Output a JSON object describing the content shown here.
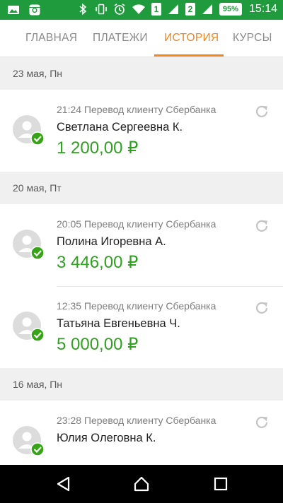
{
  "status_bar": {
    "time": "15:14",
    "battery": "95%",
    "sim1": "1",
    "sim2": "2",
    "left_icons": [
      "gallery-icon",
      "instagram-icon"
    ],
    "right_icons": [
      "bluetooth-icon",
      "vibrate-icon",
      "alarm-icon",
      "wifi-icon",
      "signal-icon"
    ]
  },
  "tabs": [
    {
      "label": "ГЛАВНАЯ",
      "active": false
    },
    {
      "label": "ПЛАТЕЖИ",
      "active": false
    },
    {
      "label": "ИСТОРИЯ",
      "active": true
    },
    {
      "label": "КУРСЫ",
      "active": false
    }
  ],
  "colors": {
    "status_bar": "#1f9a3c",
    "accent_tab": "#f0861c",
    "amount": "#2ea21f",
    "check_badge": "#37a317"
  },
  "groups": [
    {
      "date": "23 мая, Пн",
      "transactions": [
        {
          "meta": "21:24 Перевод клиенту Сбербанка",
          "name": "Светлана Сергеевна К.",
          "amount": "1 200,00 ₽"
        }
      ]
    },
    {
      "date": "20 мая, Пт",
      "transactions": [
        {
          "meta": "20:05 Перевод клиенту Сбербанка",
          "name": "Полина Игоревна А.",
          "amount": "3 446,00 ₽"
        },
        {
          "meta": "12:35 Перевод клиенту Сбербанка",
          "name": "Татьяна Евгеньевна Ч.",
          "amount": "5 000,00 ₽"
        }
      ]
    },
    {
      "date": "16 мая, Пн",
      "transactions": [
        {
          "meta": "23:28 Перевод клиенту Сбербанка",
          "name": "Юлия Олеговна К.",
          "amount": ""
        }
      ]
    }
  ],
  "nav": [
    "back-icon",
    "home-icon",
    "recents-icon"
  ]
}
